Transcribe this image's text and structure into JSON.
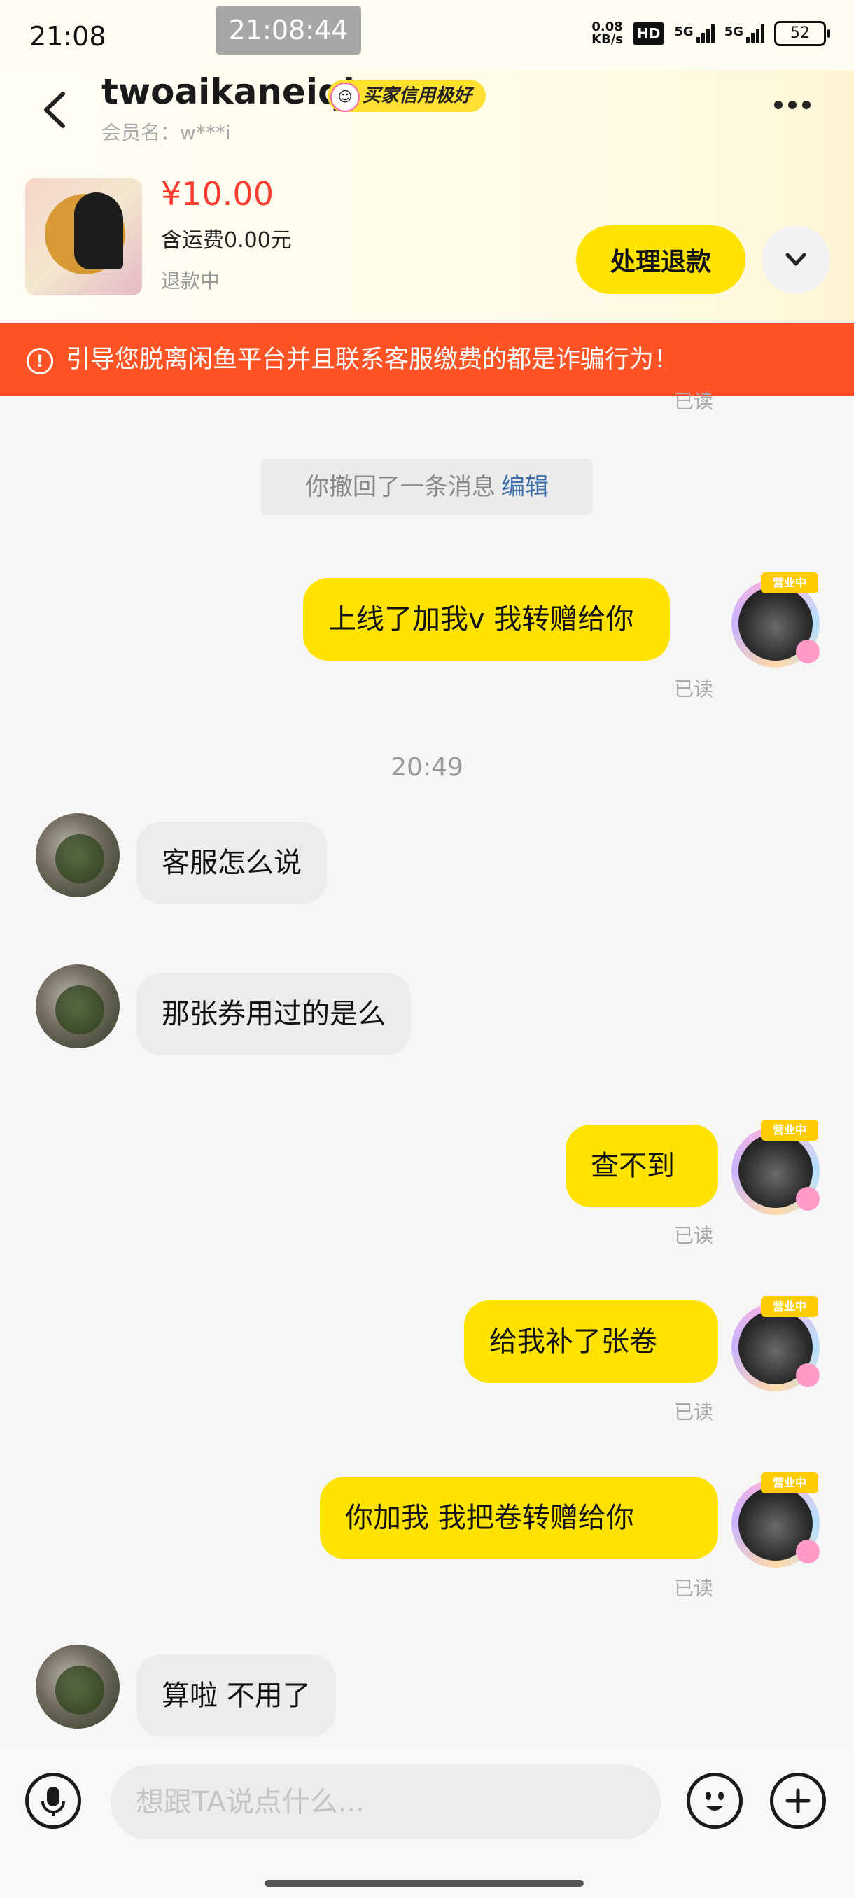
{
  "status_bar": {
    "time": "21:08",
    "floating_clock": "21:08:44",
    "net_speed_value": "0.08",
    "net_speed_unit": "KB/s",
    "hd_label": "HD",
    "signal_1": "5G",
    "signal_2": "5G",
    "battery": "52"
  },
  "header": {
    "username": "twoaikaneiqi",
    "badge": "买家信用极好",
    "member_name": "会员名：w***i",
    "icons": {
      "back": "chevron-left-icon",
      "more": "more-dots-icon",
      "expand": "chevron-down-icon"
    }
  },
  "product": {
    "price": "¥10.00",
    "shipping": "含运费0.00元",
    "status": "退款中",
    "refund_button": "处理退款"
  },
  "warning": {
    "icon": "alert-circle-icon",
    "text": "引导您脱离闲鱼平台并且联系客服缴费的都是诈骗行为！"
  },
  "chat": {
    "top_read": "已读",
    "recall": {
      "text": "你撤回了一条消息",
      "edit": "编辑"
    },
    "timestamp": "20:49",
    "messages": [
      {
        "from": "me",
        "text": "上线了加我v 我转赠给你",
        "read": "已读"
      },
      {
        "from": "other",
        "text": "客服怎么说"
      },
      {
        "from": "other",
        "text": "那张券用过的是么"
      },
      {
        "from": "me",
        "text": "查不到",
        "read": "已读"
      },
      {
        "from": "me",
        "text": "给我补了张卷",
        "read": "已读"
      },
      {
        "from": "me",
        "text": "你加我 我把卷转赠给你",
        "read": "已读"
      },
      {
        "from": "other",
        "text": "算啦 不用了"
      }
    ],
    "avatar_tag": "营业中"
  },
  "input_bar": {
    "placeholder": "想跟TA说点什么...",
    "icons": {
      "voice": "microphone-icon",
      "emoji": "emoji-icon",
      "more": "plus-icon"
    }
  },
  "colors": {
    "accent_yellow": "#ffe300",
    "warning_orange": "#fe5425",
    "price_red": "#ff3b30",
    "link_blue": "#3d6fad"
  }
}
